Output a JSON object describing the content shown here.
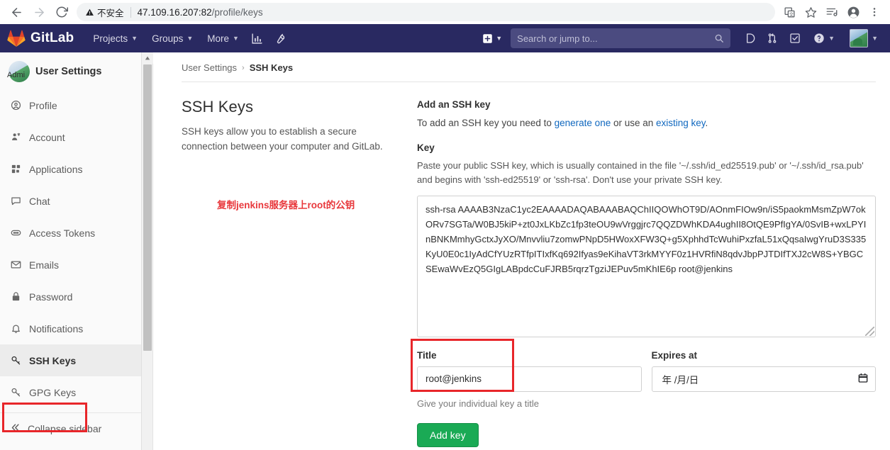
{
  "browser": {
    "back_icon": "back-arrow",
    "forward_icon": "forward-arrow",
    "reload_icon": "reload",
    "insecure_label": "不安全",
    "url_host": "47.109.16.207:82",
    "url_path": "/profile/keys",
    "icons": [
      "translate-icon",
      "bookmark-star-icon",
      "media-list-icon",
      "profile-avatar-icon",
      "more-menu-icon"
    ]
  },
  "navbar": {
    "brand": "GitLab",
    "items": [
      {
        "label": "Projects",
        "has_caret": true
      },
      {
        "label": "Groups",
        "has_caret": true
      },
      {
        "label": "More",
        "has_caret": true
      }
    ],
    "icon_buttons": [
      "analytics-chart-icon",
      "wrench-icon"
    ],
    "plus_label": "+",
    "search_placeholder": "Search or jump to...",
    "right_icons": [
      "issues-icon",
      "merge-requests-icon",
      "todos-icon",
      "help-icon",
      "user-avatar"
    ]
  },
  "sidebar": {
    "avatar_label": "Admi",
    "title": "User Settings",
    "items": [
      {
        "label": "Profile",
        "icon": "profile-icon",
        "active": false
      },
      {
        "label": "Account",
        "icon": "account-icon",
        "active": false
      },
      {
        "label": "Applications",
        "icon": "applications-icon",
        "active": false
      },
      {
        "label": "Chat",
        "icon": "chat-icon",
        "active": false
      },
      {
        "label": "Access Tokens",
        "icon": "token-icon",
        "active": false
      },
      {
        "label": "Emails",
        "icon": "email-icon",
        "active": false
      },
      {
        "label": "Password",
        "icon": "lock-icon",
        "active": false
      },
      {
        "label": "Notifications",
        "icon": "bell-icon",
        "active": false
      },
      {
        "label": "SSH Keys",
        "icon": "key-icon",
        "active": true
      },
      {
        "label": "GPG Keys",
        "icon": "key-icon",
        "active": false
      }
    ],
    "collapse_label": "Collapse sidebar"
  },
  "breadcrumb": {
    "root": "User Settings",
    "separator": "›",
    "current": "SSH Keys"
  },
  "left_panel": {
    "heading": "SSH Keys",
    "description": "SSH keys allow you to establish a secure connection between your computer and GitLab.",
    "annotation": "复制jenkins服务器上root的公钥"
  },
  "form": {
    "section_title": "Add an SSH key",
    "intro_prefix": "To add an SSH key you need to ",
    "link_generate": "generate one",
    "intro_middle": " or use an ",
    "link_existing": "existing key",
    "intro_suffix": ".",
    "key_label": "Key",
    "key_helper": "Paste your public SSH key, which is usually contained in the file '~/.ssh/id_ed25519.pub' or '~/.ssh/id_rsa.pub' and begins with 'ssh-ed25519' or 'ssh-rsa'. Don't use your private SSH key.",
    "key_value": "ssh-rsa AAAAB3NzaC1yc2EAAAADAQABAAABAQChIIQOWhOT9D/AOnmFIOw9n/iS5paokmMsmZpW7okORv7SGTa/W0BJ5kiP+zt0JxLKbZc1fp3teOU9wVrggjrc7QQZDWhKDA4ughII8OtQE9PfIgYA/0SvIB+wxLPYInBNKMmhyGctxJyXO/Mnvvliu7zomwPNpD5HWoxXFW3Q+g5XphhdTcWuhiPxzfaL51xQqsaIwgYruD3S335KyU0E0c1IyAdCfYUzRTfpITIxfKq692Ifyas9eKihaVT3rkMYYF0z1HVRfiN8qdvJbpPJTDIfTXJ2cW8S+YBGCSEwaWvEzQ5GIgLABpdcCuFJRB5rqrzTgziJEPuv5mKhIE6p root@jenkins",
    "title_label": "Title",
    "title_value": "root@jenkins",
    "title_hint": "Give your individual key a title",
    "expires_label": "Expires at",
    "expires_placeholder": "年 /月/日",
    "calendar_icon": "calendar-icon",
    "submit_label": "Add key"
  },
  "colors": {
    "navbar_bg": "#292961",
    "accent_green": "#1aaa55",
    "link_blue": "#1068bf",
    "annotation_red": "#e8262a"
  }
}
